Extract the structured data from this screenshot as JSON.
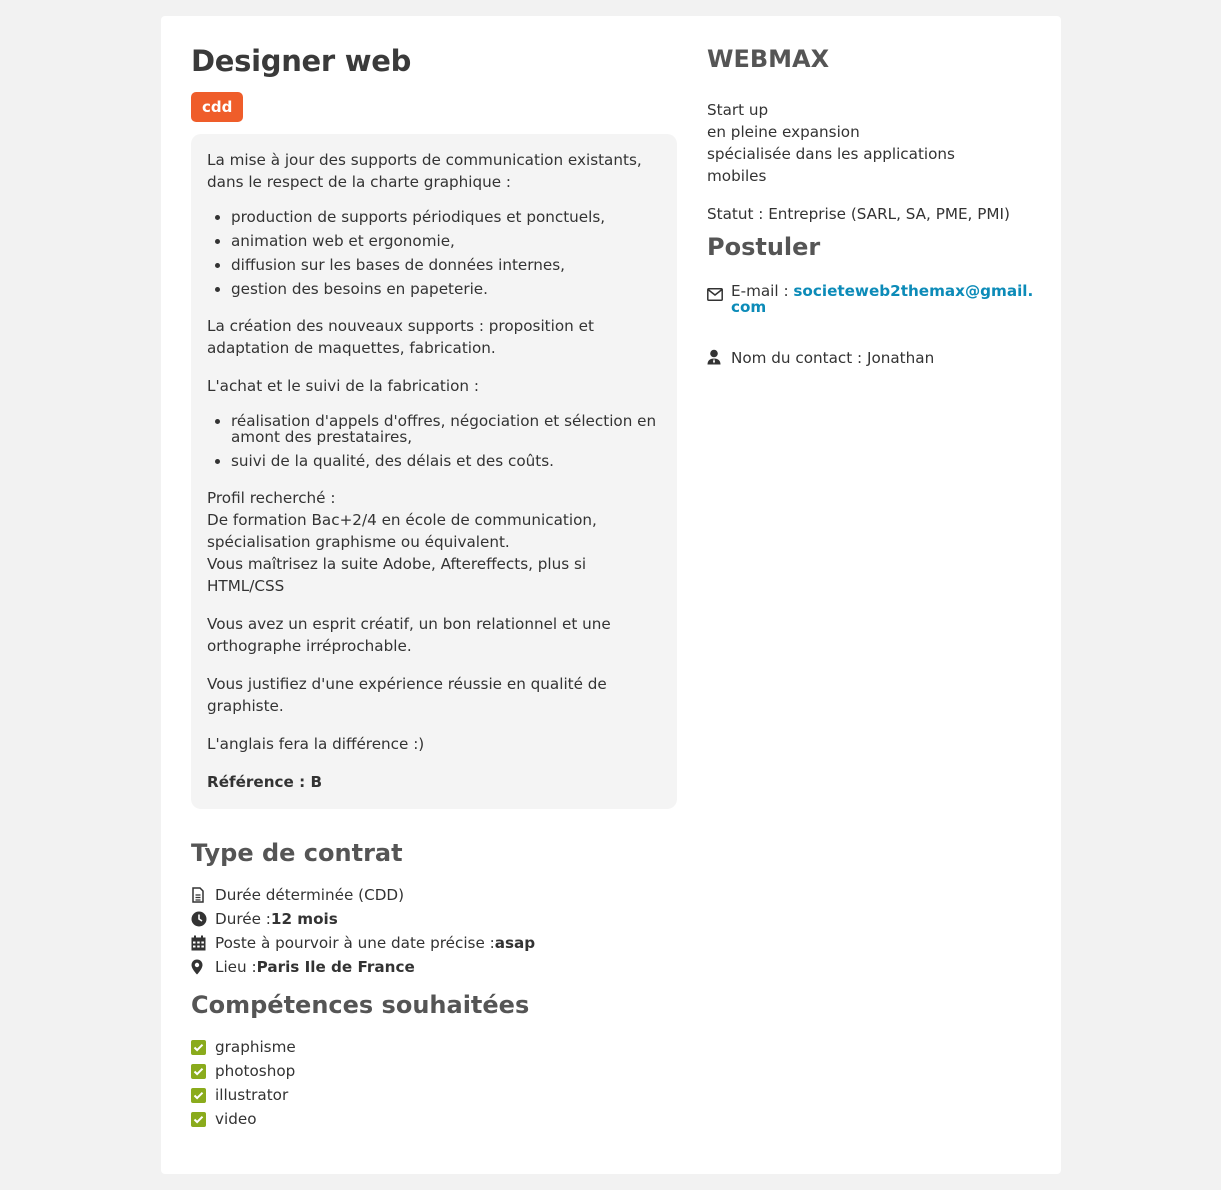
{
  "job": {
    "title": "Designer web",
    "badge": "cdd",
    "description": {
      "intro1": "La mise à jour des supports de communication existants, dans le respect de la charte graphique :",
      "list1": [
        "production de supports périodiques et ponctuels,",
        "animation web et ergonomie,",
        "diffusion sur les bases de données internes,",
        "gestion des besoins en papeterie."
      ],
      "intro2": "La création des nouveaux supports : proposition et adaptation de maquettes, fabrication.",
      "intro3": "L'achat et le suivi de la fabrication :",
      "list2": [
        "réalisation d'appels d'offres, négociation et sélection en amont des prestataires,",
        "suivi de la qualité, des délais et des coûts."
      ],
      "profile_label": "Profil recherché :",
      "profile_line1": "De formation Bac+2/4 en école de communication, spécialisation graphisme ou équivalent.",
      "profile_line2": "Vous maîtrisez la suite Adobe, Aftereffects, plus si HTML/CSS",
      "para1": "Vous avez un esprit créatif, un bon relationnel et une orthographe irréprochable.",
      "para2": "Vous justifiez d'une expérience réussie en qualité de graphiste.",
      "para3": "L'anglais fera la différence :)",
      "reference": "Référence : B"
    }
  },
  "contract": {
    "heading": "Type de contrat",
    "type": "Durée déterminée (CDD)",
    "duration_label": "Durée : ",
    "duration_value": "12 mois",
    "start_label": "Poste à pourvoir à une date précise : ",
    "start_value": "asap",
    "location_label": "Lieu : ",
    "location_value": "Paris Ile de France"
  },
  "skills": {
    "heading": "Compétences souhaitées",
    "items": [
      "graphisme",
      "photoshop",
      "illustrator",
      "video"
    ],
    "check_color": "#8aab1c"
  },
  "company": {
    "name": "WEBMAX",
    "desc_lines": [
      "Start up",
      "en pleine expansion",
      "spécialisée dans les applications",
      "mobiles"
    ],
    "statut": "Statut : Entreprise (SARL, SA, PME, PMI)"
  },
  "apply": {
    "heading": "Postuler",
    "email_label": "E-mail : ",
    "email": "societeweb2themax@gmail.com",
    "contact": "Nom du contact : Jonathan"
  },
  "colors": {
    "badge": "#ef5d2a",
    "link": "#0c8bb8"
  }
}
